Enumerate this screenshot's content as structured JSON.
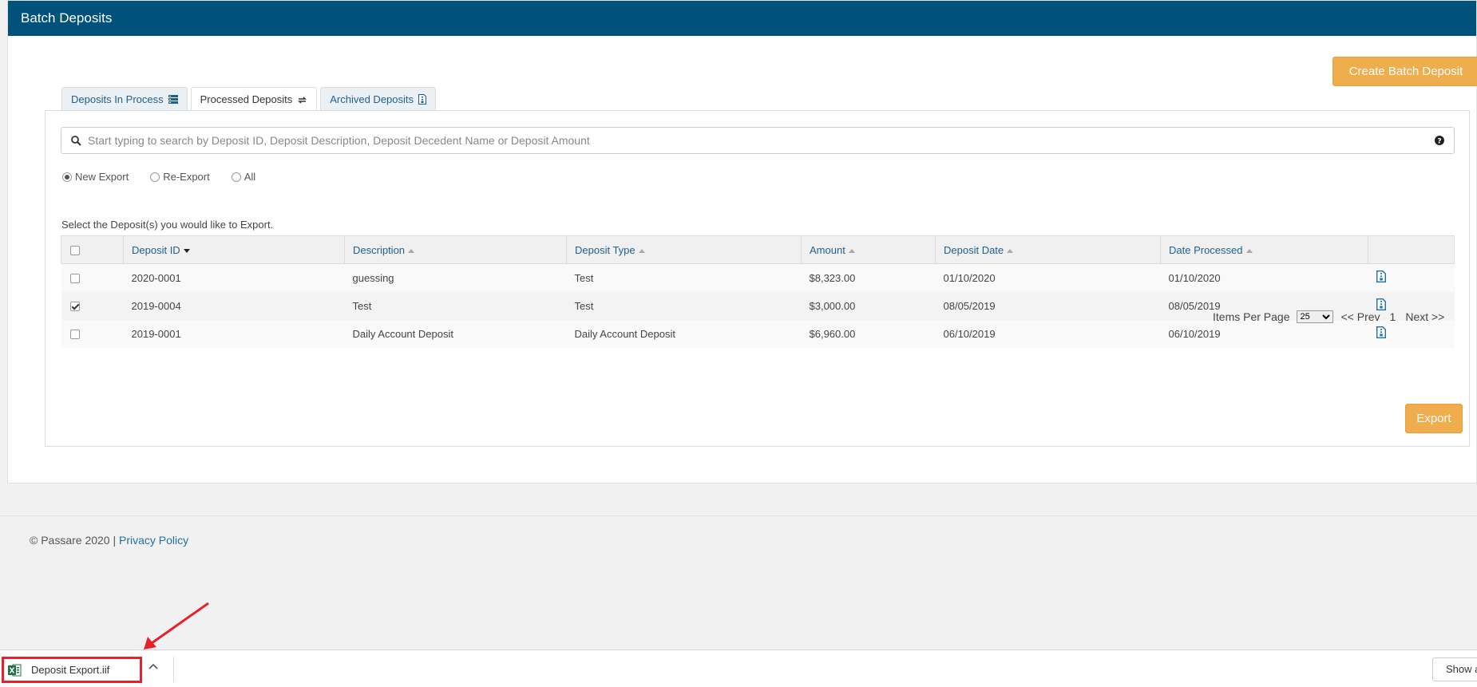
{
  "header": {
    "title": "Batch Deposits"
  },
  "toolbar": {
    "create_label": "Create Batch Deposit"
  },
  "tabs": [
    {
      "label": "Deposits In Process",
      "icon": "list-icon"
    },
    {
      "label": "Processed Deposits",
      "icon": "refresh-icon"
    },
    {
      "label": "Archived Deposits",
      "icon": "archive-file-icon"
    }
  ],
  "active_tab": "Processed Deposits",
  "search": {
    "placeholder": "Start typing to search by Deposit ID, Deposit Description, Deposit Decedent Name or Deposit Amount"
  },
  "filters": [
    {
      "label": "New Export",
      "checked": true
    },
    {
      "label": "Re-Export",
      "checked": false
    },
    {
      "label": "All",
      "checked": false
    }
  ],
  "instruction": "Select the Deposit(s) you would like to Export.",
  "table": {
    "columns": [
      "Deposit ID",
      "Description",
      "Deposit Type",
      "Amount",
      "Deposit Date",
      "Date Processed"
    ],
    "rows": [
      {
        "checked": false,
        "id": "2020-0001",
        "description": "guessing",
        "type": "Test",
        "amount": "$8,323.00",
        "deposit_date": "01/10/2020",
        "processed": "01/10/2020"
      },
      {
        "checked": true,
        "id": "2019-0004",
        "description": "Test",
        "type": "Test",
        "amount": "$3,000.00",
        "deposit_date": "08/05/2019",
        "processed": "08/05/2019"
      },
      {
        "checked": false,
        "id": "2019-0001",
        "description": "Daily Account Deposit",
        "type": "Daily Account Deposit",
        "amount": "$6,960.00",
        "deposit_date": "06/10/2019",
        "processed": "06/10/2019"
      }
    ]
  },
  "pager": {
    "items_label": "Items Per Page",
    "page_size": "25",
    "prev": "<< Prev",
    "page": "1",
    "next": "Next >>"
  },
  "export_label": "Export",
  "footer": {
    "copyright": "© Passare 2020 |",
    "privacy": "Privacy Policy"
  },
  "download_bar": {
    "file_name": "Deposit Export.iif",
    "show_all": "Show a"
  },
  "colors": {
    "header": "#00527a",
    "accent_button": "#f0ad4e",
    "link": "#1f5f8f",
    "highlight": "#e8202a"
  }
}
